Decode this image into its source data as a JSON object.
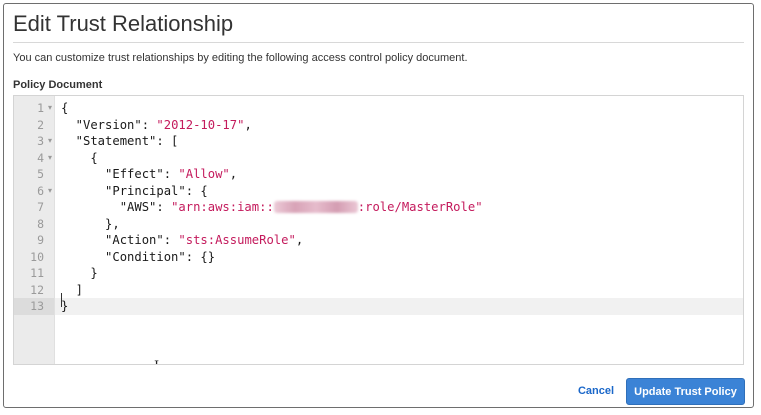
{
  "dialog": {
    "title": "Edit Trust Relationship",
    "subtitle": "You can customize trust relationships by editing the following access control policy document.",
    "section_label": "Policy Document"
  },
  "editor": {
    "active_line": 13,
    "lines": [
      {
        "num": "1",
        "fold": "▾",
        "parts": [
          {
            "t": "{",
            "c": "p"
          }
        ]
      },
      {
        "num": "2",
        "fold": "",
        "parts": [
          {
            "t": "  \"Version\": ",
            "c": "p"
          },
          {
            "t": "\"2012-10-17\"",
            "c": "s"
          },
          {
            "t": ",",
            "c": "p"
          }
        ]
      },
      {
        "num": "3",
        "fold": "▾",
        "parts": [
          {
            "t": "  \"Statement\": [",
            "c": "p"
          }
        ]
      },
      {
        "num": "4",
        "fold": "▾",
        "parts": [
          {
            "t": "    {",
            "c": "p"
          }
        ]
      },
      {
        "num": "5",
        "fold": "",
        "parts": [
          {
            "t": "      \"Effect\": ",
            "c": "p"
          },
          {
            "t": "\"Allow\"",
            "c": "s"
          },
          {
            "t": ",",
            "c": "p"
          }
        ]
      },
      {
        "num": "6",
        "fold": "▾",
        "parts": [
          {
            "t": "      \"Principal\": {",
            "c": "p"
          }
        ]
      },
      {
        "num": "7",
        "fold": "",
        "parts": [
          {
            "t": "        \"AWS\": ",
            "c": "p"
          },
          {
            "t": "\"arn:aws:iam::",
            "c": "s"
          },
          {
            "t": "",
            "c": "r"
          },
          {
            "t": ":role/MasterRole\"",
            "c": "s"
          }
        ]
      },
      {
        "num": "8",
        "fold": "",
        "parts": [
          {
            "t": "      },",
            "c": "p"
          }
        ]
      },
      {
        "num": "9",
        "fold": "",
        "parts": [
          {
            "t": "      \"Action\": ",
            "c": "p"
          },
          {
            "t": "\"sts:AssumeRole\"",
            "c": "s"
          },
          {
            "t": ",",
            "c": "p"
          }
        ]
      },
      {
        "num": "10",
        "fold": "",
        "parts": [
          {
            "t": "      \"Condition\": {}",
            "c": "p"
          }
        ]
      },
      {
        "num": "11",
        "fold": "",
        "parts": [
          {
            "t": "    }",
            "c": "p"
          }
        ]
      },
      {
        "num": "12",
        "fold": "",
        "parts": [
          {
            "t": "  ]",
            "c": "p"
          }
        ]
      },
      {
        "num": "13",
        "fold": "",
        "parts": [
          {
            "t": "}",
            "c": "p"
          }
        ]
      }
    ],
    "mouse_cursor_glyph": "I"
  },
  "buttons": {
    "cancel_label": "Cancel",
    "primary_label": "Update Trust Policy"
  },
  "colors": {
    "string": "#c41a5c",
    "primary_button": "#3b83d6",
    "link": "#1a67c9"
  }
}
